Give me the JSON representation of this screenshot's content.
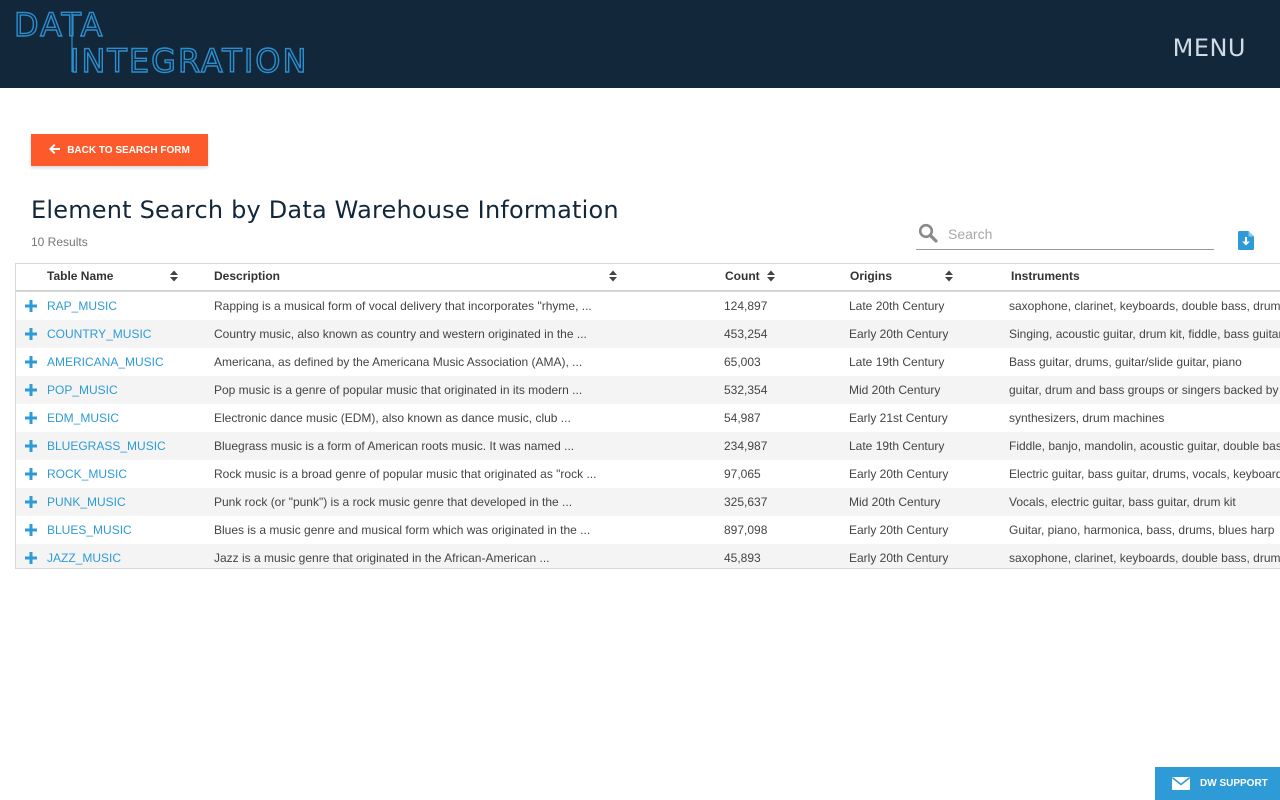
{
  "header": {
    "logo_line1": "DATA",
    "logo_line2": "INTEGRATION",
    "menu_label": "MENU"
  },
  "back_button": {
    "label": "BACK TO SEARCH FORM"
  },
  "page": {
    "title": "Element Search by Data Warehouse Information",
    "results_count": "10 Results"
  },
  "search": {
    "placeholder": "Search"
  },
  "table": {
    "columns": [
      "Table Name",
      "Description",
      "Count",
      "Origins",
      "Instruments"
    ],
    "rows": [
      {
        "name": "RAP_MUSIC",
        "description": "Rapping is a musical form of vocal delivery that incorporates \"rhyme, ...",
        "count": "124,897",
        "origins": "Late 20th Century",
        "instruments": "saxophone, clarinet, keyboards, double bass, drums"
      },
      {
        "name": "COUNTRY_MUSIC",
        "description": "Country music, also known as country and western originated in the ...",
        "count": "453,254",
        "origins": "Early 20th Century",
        "instruments": "Singing, acoustic guitar, drum kit, fiddle, bass guitar"
      },
      {
        "name": "AMERICANA_MUSIC",
        "description": "Americana, as defined by the Americana Music Association (AMA), ...",
        "count": "65,003",
        "origins": "Late 19th Century",
        "instruments": "Bass guitar, drums, guitar/slide guitar, piano"
      },
      {
        "name": "POP_MUSIC",
        "description": "Pop music is a genre of popular music that originated in its modern ...",
        "count": "532,354",
        "origins": "Mid 20th Century",
        "instruments": "guitar, drum and bass groups or singers backed by"
      },
      {
        "name": "EDM_MUSIC",
        "description": "Electronic dance music (EDM), also known as dance music, club ...",
        "count": "54,987",
        "origins": "Early 21st Century",
        "instruments": "synthesizers, drum machines"
      },
      {
        "name": "BLUEGRASS_MUSIC",
        "description": "Bluegrass music is a form of American roots music. It was named ...",
        "count": "234,987",
        "origins": "Late 19th Century",
        "instruments": "Fiddle, banjo, mandolin, acoustic guitar, double bass"
      },
      {
        "name": "ROCK_MUSIC",
        "description": "Rock music is a broad genre of popular music that originated as \"rock ...",
        "count": "97,065",
        "origins": "Early 20th Century",
        "instruments": "Electric guitar, bass guitar, drums, vocals, keyboards"
      },
      {
        "name": "PUNK_MUSIC",
        "description": "Punk rock (or \"punk\") is a rock music genre that developed in the ...",
        "count": "325,637",
        "origins": "Mid 20th Century",
        "instruments": "Vocals, electric guitar, bass guitar, drum kit"
      },
      {
        "name": "BLUES_MUSIC",
        "description": "Blues is a music genre and musical form which was originated in the ...",
        "count": "897,098",
        "origins": "Early 20th Century",
        "instruments": "Guitar, piano, harmonica, bass, drums, blues harp"
      },
      {
        "name": "JAZZ_MUSIC",
        "description": "Jazz is a music genre that originated in the African-American ...",
        "count": "45,893",
        "origins": "Early 20th Century",
        "instruments": "saxophone, clarinet, keyboards, double bass, drums"
      }
    ]
  },
  "support_button": {
    "label": "DW SUPPORT"
  },
  "colors": {
    "header_bg": "#13273a",
    "accent_orange": "#fc5a2b",
    "link_blue": "#2e9bd6"
  },
  "icons": [
    "search-icon",
    "download-icon",
    "expand-plus-icon",
    "sort-icon",
    "arrow-left-icon",
    "envelope-icon"
  ]
}
